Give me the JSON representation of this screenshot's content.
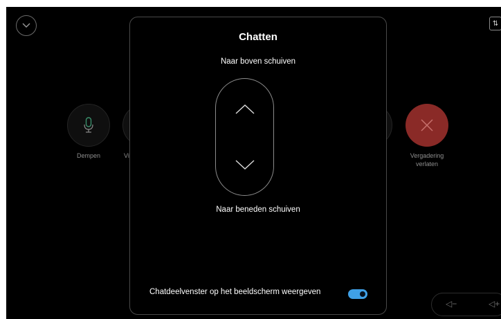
{
  "background": {
    "controls": {
      "mute_label": "Dempen",
      "partial_label": "Vi",
      "leave_label_line1": "Vergadering",
      "leave_label_line2": "verlaten"
    }
  },
  "dialog": {
    "title": "Chatten",
    "scroll_up_hint": "Naar boven schuiven",
    "scroll_down_hint": "Naar beneden schuiven",
    "toggle_label": "Chatdeelvenster op het beeldscherm weergeven",
    "toggle_state": "on"
  },
  "colors": {
    "accent": "#3fa0e6",
    "leave": "#8a2a27",
    "mic": "#3a8f6b"
  },
  "icons": [
    "chevron-down-icon",
    "microphone-icon",
    "close-icon",
    "chevron-up-icon",
    "volume-down-icon",
    "volume-up-icon",
    "swap-icon"
  ]
}
